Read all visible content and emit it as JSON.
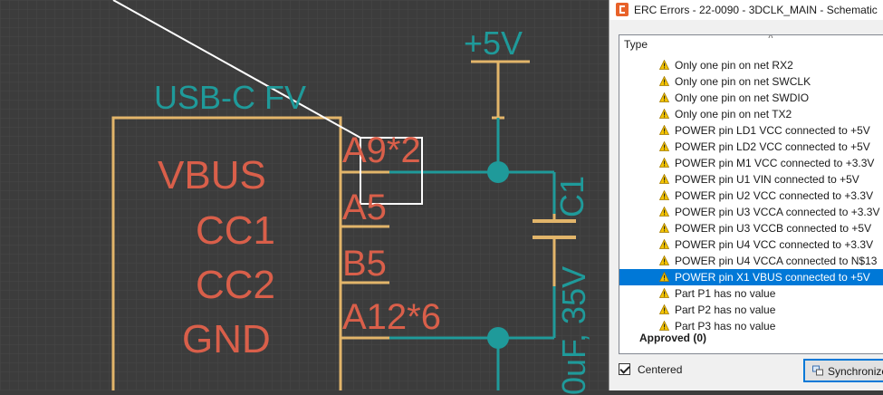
{
  "schematic": {
    "net_label": "+5V",
    "part_name": "USB-C FV",
    "pin_names": [
      "VBUS",
      "CC1",
      "CC2",
      "GND"
    ],
    "pin_numbers": [
      "A9*2",
      "A5",
      "B5",
      "A12*6"
    ],
    "cap_name": "C1",
    "cap_value": "0uF, 35V",
    "colors": {
      "background": "#3c3c3c",
      "wire": "#1f9a9a",
      "part": "#d95f4a",
      "pin": "#e2b56a",
      "highlight": "#ffffff"
    }
  },
  "panel": {
    "title": "ERC Errors - 22-0090 - 3DCLK_MAIN - Schematic",
    "column_header": "Type",
    "rows": [
      {
        "text": "Only one pin on net RX2",
        "selected": false
      },
      {
        "text": "Only one pin on net SWCLK",
        "selected": false
      },
      {
        "text": "Only one pin on net SWDIO",
        "selected": false
      },
      {
        "text": "Only one pin on net TX2",
        "selected": false
      },
      {
        "text": "POWER pin LD1 VCC connected to +5V",
        "selected": false
      },
      {
        "text": "POWER pin LD2 VCC connected to +5V",
        "selected": false
      },
      {
        "text": "POWER pin M1 VCC connected to +3.3V",
        "selected": false
      },
      {
        "text": "POWER pin U1 VIN connected to +5V",
        "selected": false
      },
      {
        "text": "POWER pin U2 VCC connected to +3.3V",
        "selected": false
      },
      {
        "text": "POWER pin U3 VCCA connected to +3.3V",
        "selected": false
      },
      {
        "text": "POWER pin U3 VCCB connected to +5V",
        "selected": false
      },
      {
        "text": "POWER pin U4 VCC connected to +3.3V",
        "selected": false
      },
      {
        "text": "POWER pin U4 VCCA connected to N$13",
        "selected": false
      },
      {
        "text": "POWER pin X1 VBUS connected to +5V",
        "selected": true
      },
      {
        "text": "Part P1 has no value",
        "selected": false
      },
      {
        "text": "Part P2 has no value",
        "selected": false
      },
      {
        "text": "Part P3 has no value",
        "selected": false
      }
    ],
    "group_label": "Approved (0)",
    "centered_label": "Centered",
    "centered_checked": true,
    "sync_button": "Synchronize"
  },
  "icons": {
    "app": "eagle-app-icon",
    "row": "warning-icon",
    "sync": "synchronize-icon"
  }
}
